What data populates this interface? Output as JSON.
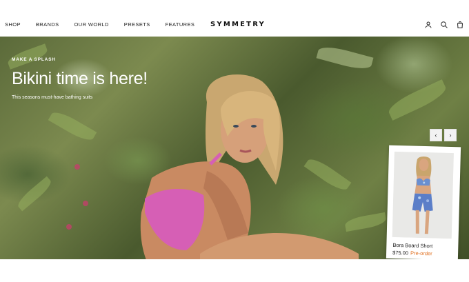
{
  "header": {
    "nav": [
      "SHOP",
      "BRANDS",
      "OUR WORLD",
      "PRESETS",
      "FEATURES"
    ],
    "brand": "SYMMETRY",
    "icons": [
      "account-icon",
      "search-icon",
      "bag-icon"
    ]
  },
  "hero": {
    "kicker": "MAKE A SPLASH",
    "title": "Bikini time is here!",
    "subtitle": "This seasons must-have bathing suits",
    "prev_label": "‹",
    "next_label": "›"
  },
  "product": {
    "name": "Bora Board Short",
    "price": "$75.00",
    "status": "Pre-order"
  },
  "colors": {
    "accent_preorder": "#e07020",
    "swimsuit_pink": "#d65fb5"
  }
}
